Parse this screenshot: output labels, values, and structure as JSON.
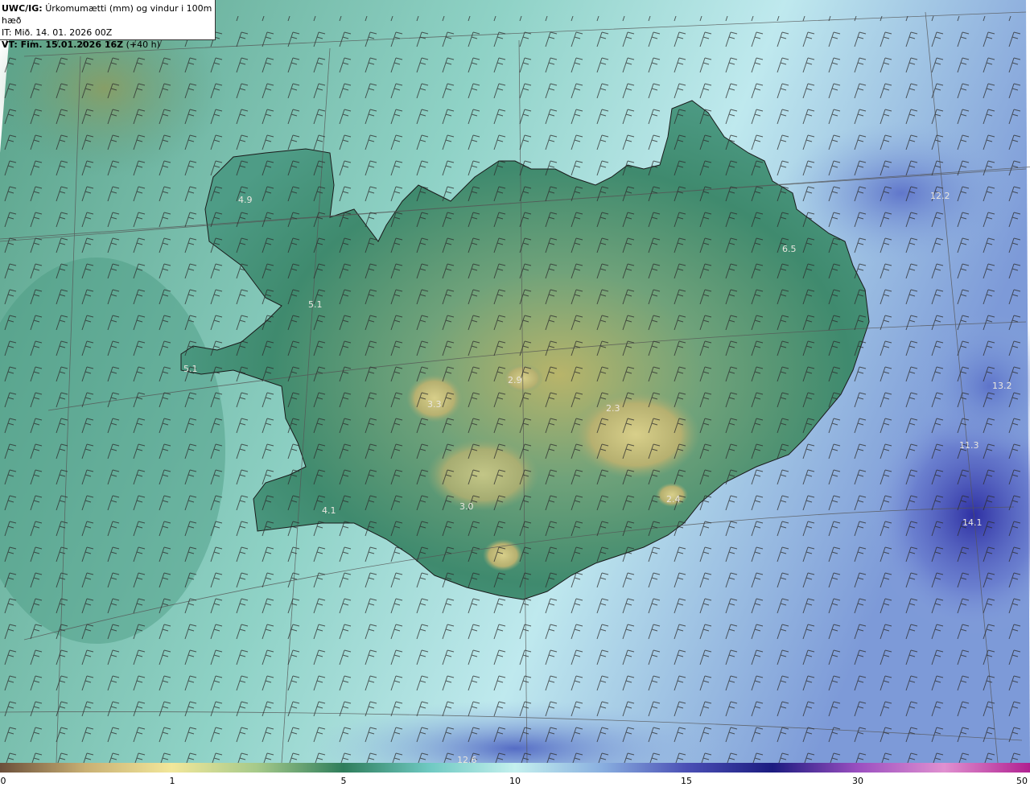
{
  "header": {
    "product_code": "UWC/IG:",
    "product_desc": "Úrkomumætti (mm) og vindur i 100m hæð",
    "issue_time": "IT: Mið. 14. 01. 2026 00Z",
    "valid_label": "VT: Fim. 15.01.2026 16Z",
    "valid_lead": "(+40 h)"
  },
  "map_labels": [
    {
      "name": "value-label-westfjords",
      "text": "4.9"
    },
    {
      "name": "value-label-snaefellsnes",
      "text": "5.1"
    },
    {
      "name": "value-label-reykjanes-west",
      "text": "5.1"
    },
    {
      "name": "value-label-langjokull",
      "text": "3.3"
    },
    {
      "name": "value-label-hofsjokull",
      "text": "2.9"
    },
    {
      "name": "value-label-vatnajokull",
      "text": "2.3"
    },
    {
      "name": "value-label-southwest",
      "text": "4.1"
    },
    {
      "name": "value-label-myrdalsjokull",
      "text": "3.0"
    },
    {
      "name": "value-label-oraefajokull",
      "text": "2.4"
    },
    {
      "name": "value-label-east",
      "text": "6.5"
    },
    {
      "name": "value-label-northeast-sea",
      "text": "12.2"
    },
    {
      "name": "value-label-east-sea",
      "text": "13.2"
    },
    {
      "name": "value-label-east-sea-2",
      "text": "11.3"
    },
    {
      "name": "value-label-southeast-sea",
      "text": "14.1"
    },
    {
      "name": "value-label-south-sea",
      "text": "12.6"
    }
  ],
  "colorbar": {
    "ticks": [
      "0",
      "1",
      "5",
      "10",
      "15",
      "30",
      "50"
    ],
    "stops": [
      "#6b4f3a",
      "#c9b074",
      "#f2e79a",
      "#a5c98a",
      "#2e7d5b",
      "#6fc9c2",
      "#c4f0ee",
      "#8ab0e0",
      "#4a4fb5",
      "#1b1b80",
      "#9b4fc0",
      "#e090d0",
      "#b02090"
    ]
  }
}
